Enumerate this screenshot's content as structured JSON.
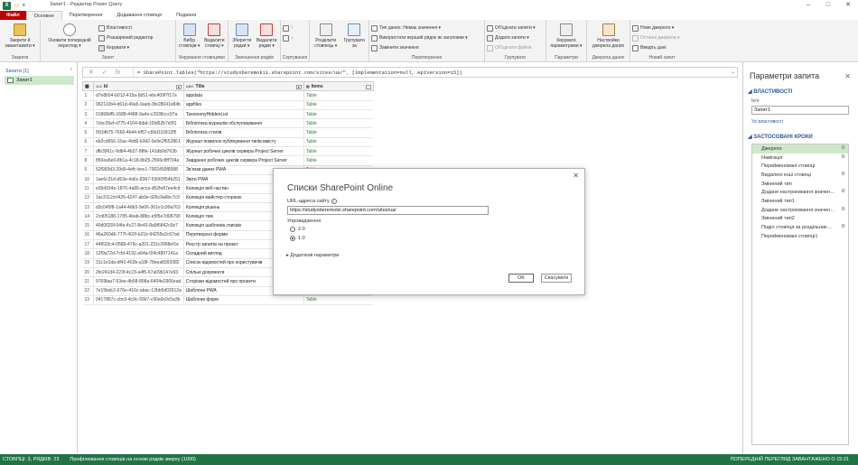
{
  "window": {
    "title": "Запит1 - Редактор Power Query",
    "icons": [
      "excel-icon",
      "smiley-icon"
    ]
  },
  "tabs": [
    "Файл",
    "Основне",
    "Перетворення",
    "Додавання стовпця",
    "Подання"
  ],
  "ribbon": {
    "close_apply": "Закрити й завантажити ▾",
    "refresh_preview": "Оновити попередній перегляд ▾",
    "properties": "Властивості",
    "advanced_editor": "Розширений редактор",
    "manage": "Керувати ▾",
    "choose_columns": "Вибір стовпців ▾",
    "remove_columns": "Видалити стовпці ▾",
    "keep_rows": "Зберегти рядки ▾",
    "remove_rows": "Видалити рядки ▾",
    "sort_asc": "↑",
    "sort_desc": "↓",
    "split_column": "Розділити стовпець ▾",
    "group_by": "Групувати за",
    "data_type": "Тип даних: Немає значення ▾",
    "use_first_row": "Використати перший рядок як заголовки ▾",
    "replace_values": "Замінити значення",
    "merge_queries": "Об'єднати запити ▾",
    "append_queries": "Додати запити ▾",
    "combine_files": "Об'єднати файли",
    "manage_params": "Керувати параметрами ▾",
    "data_source_settings": "Настройки джерела даних",
    "new_source": "Нове джерело ▾",
    "recent_sources": "Останні джерела ▾",
    "enter_data": "Введіть дані",
    "groups": [
      "Закрити",
      "Запит",
      "Керування стовпцями",
      "Зменшення рядків",
      "Сортування",
      "Перетворення",
      "Групування",
      "Групувати",
      "Параметри",
      "Джерела даних",
      "Новий запит"
    ]
  },
  "formula": {
    "cancel": "✕",
    "confirm": "✓",
    "fx": "fx",
    "text": "= SharePoint.Tables(\"https://studyoberemokii.sharepoint.com/sites/ua/\", [Implementation=null, ApiVersion=15])"
  },
  "queries": {
    "header": "Запити [1]",
    "items": [
      "Запит1"
    ]
  },
  "grid": {
    "columns": [
      {
        "type": "123",
        "name": "Id"
      },
      {
        "type": "ABC",
        "name": "Title"
      },
      {
        "type": "",
        "name": "Items"
      }
    ],
    "rows": [
      [
        "1",
        "d7e8b04-b013-415a-bb51-ebc409f7f17e",
        "appdata",
        "Table"
      ],
      [
        "2",
        "062110b4-d61d-49a5-9aeb-3fe28041e84b",
        "appfiles",
        "Table"
      ],
      [
        "3",
        "01868df5-1688-4488-9a4e-c2938ccc97a",
        "TaxonomyHiddenList",
        "Table"
      ],
      [
        "4",
        "7cbc35ef-d775-4104-8daf-1f3d52b7d3f1",
        "Бібліотека журналів обслуговування",
        "Table"
      ],
      [
        "5",
        "5f1bfb75-7660-4b44-bf57-c66d110912f5",
        "Бібліотека стилів",
        "Table"
      ],
      [
        "6",
        "eb2cd656-15ac-4dd6-b3d2-0e9e2f552861",
        "Журнал помилок публікування типів вмісту",
        "Table"
      ],
      [
        "7",
        "dfb3961c-9db4-4b27-88fe-141db0d763b",
        "Журнал робочих циклів сервера Project Server",
        "Table"
      ],
      [
        "8",
        "850ea5e0-8b1a-4c18-8b25-2566c8ff704a",
        "Завдання робочих циклів сервера Project Server",
        "Table"
      ],
      [
        "9",
        "52f993d3-29d9-4efc-bec1-7002450f8998",
        "Зв'язки даних PWA",
        "Table"
      ],
      [
        "10",
        "1ae6c31d-d53e-4a6c-8367-53065f54b251",
        "Звіти PWA",
        "Table"
      ],
      [
        "11",
        "e05d934e-1876-4a89-acca-d52fe87ee4cd",
        "Колекція веб-частин",
        "Table"
      ],
      [
        "12",
        "1ac3112d-f426-4247-ab9e-d26c9a6bc7c9",
        "Колекція майстер-сторінок",
        "Table"
      ],
      [
        "13",
        "d3c045f8-1a44-4db3-9e06-301e1c99a763",
        "Колекція рішень",
        "Table"
      ],
      [
        "14",
        "2cd05188-1785-4bab-88bc-e5f5e7d08790",
        "Колекція тем",
        "Table"
      ],
      [
        "15",
        "40d0020f-04fa-4c27-8e43-8a9f6842c0e7",
        "Колекція шаблонів списків",
        "Table"
      ],
      [
        "16",
        "46a260d6-777f-402f-b21b-94255e2c07ad",
        "Перетворені форми",
        "Table"
      ],
      [
        "17",
        "44f633c4-0589-476c-a201-231c3968ef1e",
        "Реєстр запитів на проект",
        "Table"
      ],
      [
        "18",
        "12f9a72d-7cfd-4192-a64a-f24c4897141a",
        "Складний вигляд",
        "Table"
      ],
      [
        "19",
        "31c1e1da-df42-402b-a18f-78eea8392082",
        "Список відомостей про користувачів",
        "Table"
      ],
      [
        "20",
        "2fe241d4-223f-4c23-a4f5-67a09b147e93",
        "Спільні документи",
        "Table"
      ],
      [
        "21",
        "9769faa7-63ee-4b58-898a-6404e2906ead",
        "Сторінки відомостей про проекти",
        "Table"
      ],
      [
        "22",
        "7e15bdc2-676e-416c-abac-12bb5d02912a",
        "Шаблони PWA",
        "Table"
      ],
      [
        "23",
        "0417867c-cbc9-4c9c-93b7-c90a9c0c5a3b",
        "Шаблони форм",
        "Table"
      ]
    ]
  },
  "settings": {
    "title": "Параметри запита",
    "close": "✕",
    "props_header": "ВЛАСТИВОСТІ",
    "name_label": "Ім'я",
    "name_value": "Запит1",
    "all_props": "Усі властивості",
    "steps_header": "ЗАСТОСОВАНІ КРОКИ",
    "steps": [
      {
        "label": "Джерело",
        "gear": true
      },
      {
        "label": "Навігація",
        "gear": true
      },
      {
        "label": "Перейменовані стовпці",
        "gear": false
      },
      {
        "label": "Видалені інші стовпці",
        "gear": true
      },
      {
        "label": "Змінений тип",
        "gear": false
      },
      {
        "label": "Додане настроювання значен…",
        "gear": true
      },
      {
        "label": "Змінений тип1",
        "gear": false
      },
      {
        "label": "Додане настроювання значен…",
        "gear": true
      },
      {
        "label": "Змінений тип2",
        "gear": false
      },
      {
        "label": "Поділ стовпця за роздільник…",
        "gear": true
      },
      {
        "label": "Перейменовані стовпці1",
        "gear": false
      }
    ]
  },
  "dialog": {
    "title": "Списки SharePoint Online",
    "url_label": "URL-адреса сайту",
    "url_value": "https://studyoberemokii.sharepoint.com/sites/ua/",
    "impl_label": "Упровадження",
    "options": [
      "2.0",
      "1.0"
    ],
    "selected": "1.0",
    "advanced": "Додаткові параметри",
    "ok": "OK",
    "cancel": "Скасувати",
    "close": "✕"
  },
  "status": {
    "columns_rows": "СТОВПЦІ: 3, РЯДКІВ: 23",
    "profiling": "Профілювання стовпців на основі рядків зверху (1000)",
    "preview": "ПОПЕРЕДНІЙ ПЕРЕГЛЯД ЗАВАНТАЖЕНО О 15:21"
  },
  "colors": {
    "accent": "#217346",
    "file_tab": "#c00000",
    "selection": "#cde8cd",
    "link": "#2b579a"
  }
}
